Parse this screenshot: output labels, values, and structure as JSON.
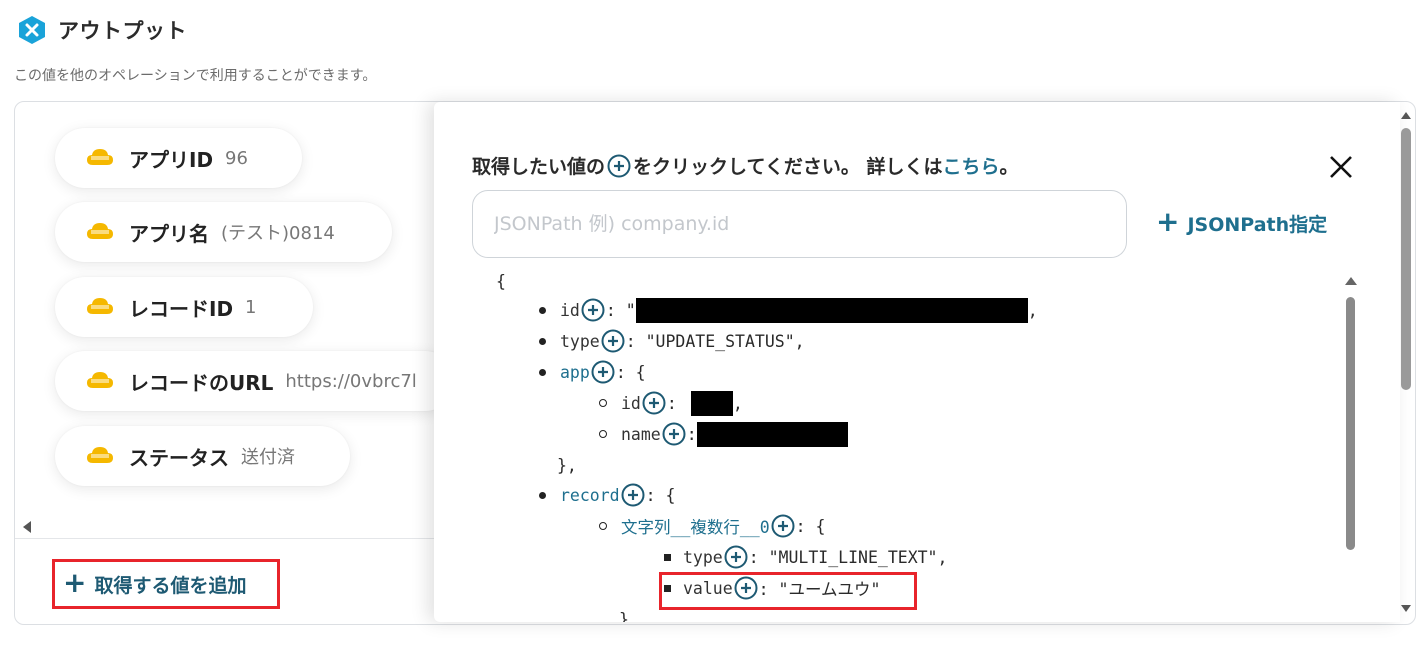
{
  "header": {
    "title": "アウトプット",
    "subtitle": "この値を他のオペレーションで利用することができます。"
  },
  "outputs": [
    {
      "label": "アプリID",
      "value": "96",
      "icon": "kintone-icon"
    },
    {
      "label": "アプリ名",
      "value": "(テスト)0814",
      "icon": "kintone-icon"
    },
    {
      "label": "レコードID",
      "value": "1",
      "icon": "kintone-icon"
    },
    {
      "label": "レコードのURL",
      "value": "https://0vbrc7l",
      "icon": "kintone-icon"
    },
    {
      "label": "ステータス",
      "value": "送付済",
      "icon": "kintone-icon"
    }
  ],
  "add_button": {
    "label": "取得する値を追加"
  },
  "popup": {
    "instruction_before": "取得したい値の",
    "instruction_after": "をクリックしてください。 詳しくは",
    "instruction_link": "こちら",
    "instruction_end": "。",
    "search_placeholder": "JSONPath 例) company.id",
    "jsonpath_button": "JSONPath指定"
  },
  "tree": {
    "open_brace": "{",
    "id_key": "id",
    "id_sep": ": \"",
    "id_trail": ",",
    "type_key": "type",
    "type_value": ": \"UPDATE_STATUS\",",
    "app_key": "app",
    "app_open": ": {",
    "app_id_key": "id",
    "app_id_sep": ":",
    "app_id_trail": ",",
    "app_name_key": "name",
    "app_name_sep": ":",
    "app_close": "},",
    "record_key": "record",
    "record_open": ": {",
    "field_key": "文字列__複数行__0",
    "field_open": ": {",
    "ftype_key": "type",
    "ftype_value": ": \"MULTI_LINE_TEXT\",",
    "fvalue_key": "value",
    "fvalue_value": ": \"ユームユウ\"",
    "field_close": "},"
  },
  "colors": {
    "accent": "#1e6f8e",
    "highlight_border": "#e8242b",
    "kintone_yellow": "#f5b800"
  }
}
